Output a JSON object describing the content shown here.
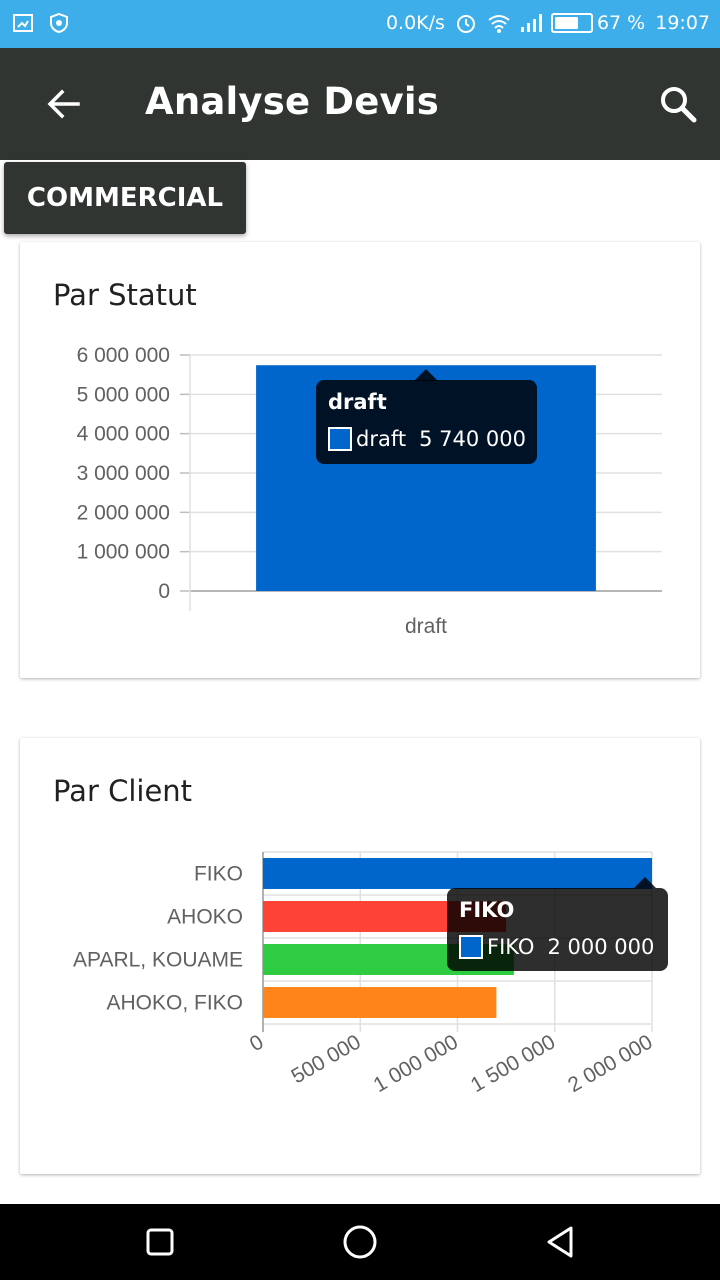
{
  "status_bar": {
    "speed": "0.0K/s",
    "battery": "67 %",
    "battery_level": 0.67,
    "time": "19:07",
    "icons": [
      "screen-cast-icon",
      "shield-icon",
      "alarm-icon",
      "wifi-icon",
      "signal-icon",
      "battery-icon"
    ]
  },
  "app_bar": {
    "title": "Analyse Devis",
    "back_icon": "back-arrow-icon",
    "search_icon": "search-icon"
  },
  "commercial_button": {
    "label": "COMMERCIAL"
  },
  "colors": {
    "status_bar": "#3daee9",
    "app_bar": "#313532"
  },
  "cards": {
    "statut": {
      "title": "Par Statut",
      "tooltip": {
        "title": "draft",
        "series": "draft",
        "value": "5 740 000",
        "color": "#0066cc"
      }
    },
    "client": {
      "title": "Par Client",
      "tooltip": {
        "title": "FIKO",
        "series": "FIKO",
        "value": "2 000 000",
        "color": "#0066cc"
      }
    }
  },
  "chart_data": [
    {
      "type": "bar",
      "title": "Par Statut",
      "categories": [
        "draft"
      ],
      "values": [
        5740000
      ],
      "colors": [
        "#0066cc"
      ],
      "ylim": [
        0,
        6000000
      ],
      "yticks": [
        0,
        1000000,
        2000000,
        3000000,
        4000000,
        5000000,
        6000000
      ],
      "ytick_labels": [
        "0",
        "1 000 000",
        "2 000 000",
        "3 000 000",
        "4 000 000",
        "5 000 000",
        "6 000 000"
      ],
      "grid": true
    },
    {
      "type": "bar",
      "orientation": "horizontal",
      "title": "Par Client",
      "categories": [
        "FIKO",
        "AHOKO",
        "APARL, KOUAME",
        "AHOKO, FIKO"
      ],
      "values": [
        2000000,
        1250000,
        1290000,
        1200000
      ],
      "colors": [
        "#0066cc",
        "#ff4136",
        "#2ecc40",
        "#ff851b"
      ],
      "xlim": [
        0,
        2000000
      ],
      "xticks": [
        0,
        500000,
        1000000,
        1500000,
        2000000
      ],
      "xtick_labels": [
        "0",
        "500 000",
        "1 000 000",
        "1 500 000",
        "2 000 000"
      ],
      "grid": true
    }
  ],
  "nav_bar": {
    "icons": [
      "recent-apps-icon",
      "home-icon",
      "back-nav-icon"
    ]
  }
}
